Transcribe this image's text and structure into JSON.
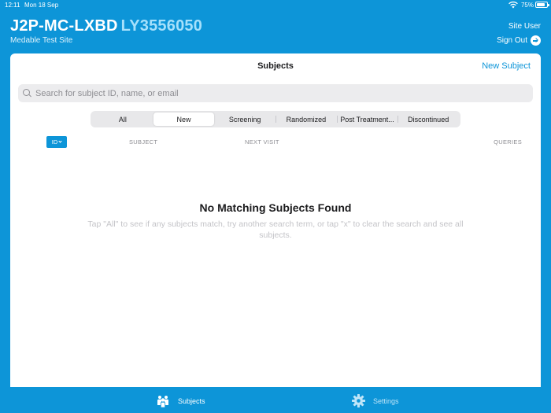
{
  "status_bar": {
    "time": "12:11",
    "date": "Mon 18 Sep",
    "battery": "75%"
  },
  "header": {
    "study_code": "J2P-MC-LXBD",
    "study_id": "LY3556050",
    "site_name": "Medable Test Site",
    "user_role": "Site User",
    "sign_out_label": "Sign Out"
  },
  "main": {
    "title": "Subjects",
    "new_subject_label": "New Subject",
    "search": {
      "placeholder": "Search for subject ID, name, or email",
      "value": ""
    },
    "filters": [
      "All",
      "New",
      "Screening",
      "Randomized",
      "Post Treatment...",
      "Discontinued"
    ],
    "active_filter": "New",
    "sort_button_label": "ID",
    "columns": {
      "subject": "SUBJECT",
      "next_visit": "NEXT VISIT",
      "queries": "QUERIES"
    },
    "empty_title": "No Matching Subjects Found",
    "empty_message": "Tap \"All\" to see if any subjects match, try another search term, or tap \"x\" to clear the search and see all subjects."
  },
  "tab_bar": {
    "subjects_label": "Subjects",
    "settings_label": "Settings",
    "active": "Subjects"
  },
  "colors": {
    "brand": "#0d95d8",
    "study_id": "#a6e0fb"
  }
}
